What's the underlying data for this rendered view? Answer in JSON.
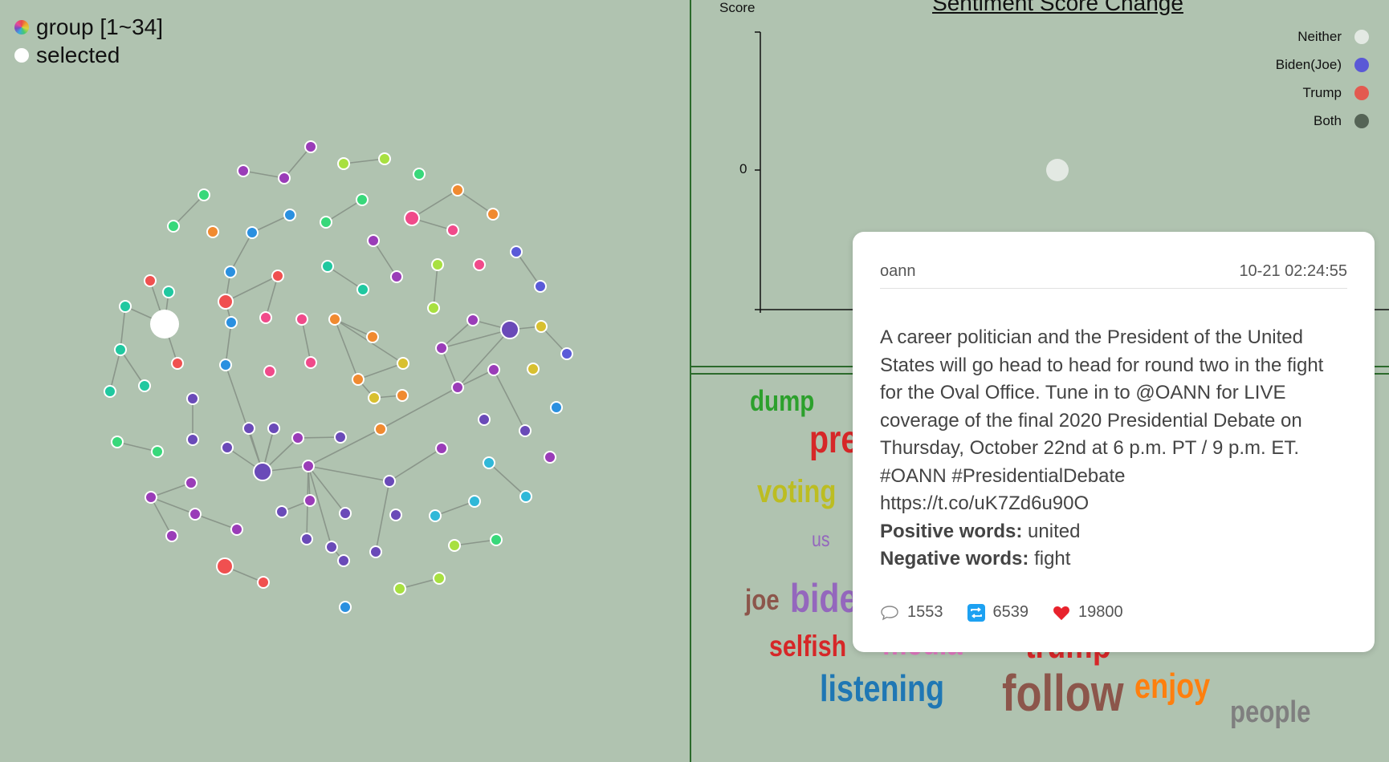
{
  "legend": {
    "group_label": "group [1~34]",
    "selected_label": "selected"
  },
  "chart": {
    "title": "Sentiment Score Change",
    "y_axis_label": "Score",
    "zero_tick": "0",
    "legend": [
      {
        "label": "Neither",
        "color": "#e3e9e3"
      },
      {
        "label": "Biden(Joe)",
        "color": "#5a58d6"
      },
      {
        "label": "Trump",
        "color": "#e35a50"
      },
      {
        "label": "Both",
        "color": "#556456"
      }
    ],
    "points": [
      {
        "category": "Neither",
        "score": 0
      }
    ]
  },
  "tweet": {
    "user": "oann",
    "time": "10-21 02:24:55",
    "text": "A career politician and the President of the United States will go head to head for round two in the fight for the Oval Office. Tune in to @OANN for LIVE coverage of the final 2020 Presidential Debate on Thursday, October 22nd at 6 p.m. PT / 9 p.m. ET. #OANN #PresidentialDebate",
    "link": "https://t.co/uK7Zd6u90O",
    "positive_label": "Positive words:",
    "positive_words": "united",
    "negative_label": "Negative words:",
    "negative_words": "fight",
    "replies": "1553",
    "retweets": "6539",
    "likes": "19800"
  },
  "word_cloud": [
    {
      "text": "dump",
      "color": "#2ca02c"
    },
    {
      "text": "pre",
      "color": "#d62728"
    },
    {
      "text": "voting",
      "color": "#bcbd22"
    },
    {
      "text": "us",
      "color": "#9467bd"
    },
    {
      "text": "joe",
      "color": "#8c564b"
    },
    {
      "text": "bide",
      "color": "#9467bd"
    },
    {
      "text": "selfish",
      "color": "#d62728"
    },
    {
      "text": "media",
      "color": "#e377c2"
    },
    {
      "text": "trump",
      "color": "#d62728"
    },
    {
      "text": "listening",
      "color": "#1f77b4"
    },
    {
      "text": "follow",
      "color": "#8c564b"
    },
    {
      "text": "enjoy",
      "color": "#ff7f0e"
    },
    {
      "text": "people",
      "color": "#7f7f7f"
    }
  ]
}
